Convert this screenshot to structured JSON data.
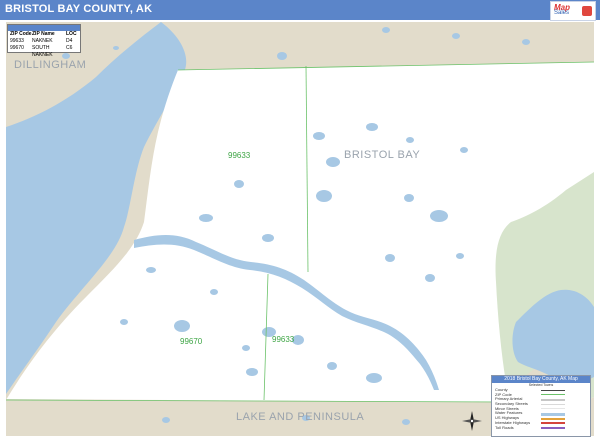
{
  "header": {
    "title": "BRISTOL BAY COUNTY, AK",
    "brand": {
      "line1": "Map",
      "line2": "Sales",
      "accent_color": "#e0473e"
    }
  },
  "colors": {
    "header_bg": "#5b85c9",
    "water": "#a7c8e4",
    "neighbor_land": "#e2dccb",
    "park": "#d7e4cc",
    "county_land": "#ffffff",
    "zip_boundary": "#6cc26a",
    "county_label": "#9aa3ad",
    "zip_label": "#3ea545"
  },
  "map": {
    "county_label": "BRISTOL BAY",
    "neighbors": [
      {
        "label": "DILLINGHAM"
      },
      {
        "label": "LAKE AND PENINSULA"
      }
    ],
    "zip_labels": [
      "99633",
      "99670",
      "99633"
    ]
  },
  "zip_table": {
    "headers": [
      "ZIP Code",
      "ZIP Name",
      "LOC"
    ],
    "rows": [
      {
        "zip": "99633",
        "name": "NAKNEK",
        "loc": "D4"
      },
      {
        "zip": "99670",
        "name": "SOUTH NAKNEK",
        "loc": "C6"
      }
    ]
  },
  "legend": {
    "title": "2018 Bristol Bay County, AK Map",
    "subtitle": "Selected Towns",
    "items": [
      {
        "label": "County",
        "icon": "county-symbol"
      },
      {
        "label": "ZIP Code",
        "icon": "zip-symbol"
      },
      {
        "label": "Primary Arterial",
        "icon": "primary-arterial-symbol"
      },
      {
        "label": "Secondary Streets",
        "icon": "secondary-streets-symbol"
      },
      {
        "label": "Minor Streets",
        "icon": "minor-streets-symbol"
      },
      {
        "label": "Water Features",
        "icon": "water-symbol"
      },
      {
        "label": "US Highways",
        "icon": "us-highway-symbol"
      },
      {
        "label": "Interstate Highways",
        "icon": "interstate-symbol"
      },
      {
        "label": "Toll Roads",
        "icon": "toll-road-symbol"
      }
    ]
  }
}
